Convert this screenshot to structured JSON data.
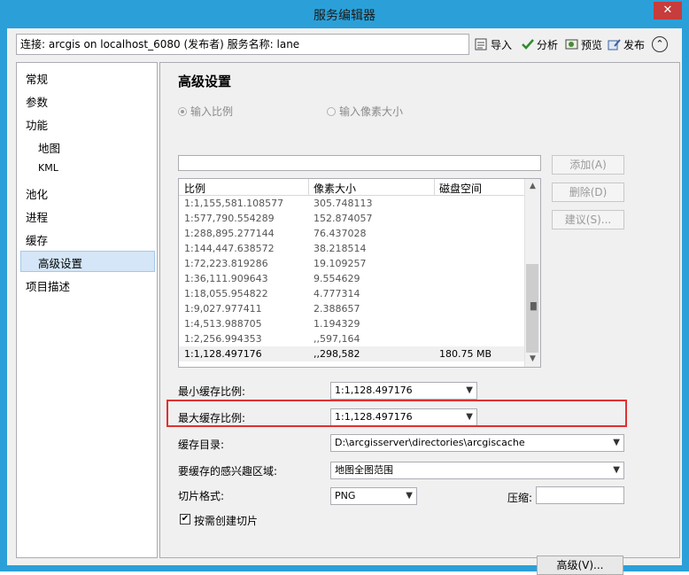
{
  "window": {
    "title": "服务编辑器",
    "close_glyph": "✕"
  },
  "toolbar": {
    "connection": "连接: arcgis on localhost_6080 (发布者)    服务名称: lane",
    "import_label": "导入",
    "analyze_label": "分析",
    "preview_label": "预览",
    "publish_label": "发布",
    "collapse_glyph": "⌃"
  },
  "sidebar": {
    "items": [
      {
        "label": "常规"
      },
      {
        "label": "参数"
      },
      {
        "label": "功能"
      },
      {
        "label": "地图"
      },
      {
        "label": "KML"
      },
      {
        "label": "池化"
      },
      {
        "label": "进程"
      },
      {
        "label": "缓存"
      },
      {
        "label": "高级设置"
      },
      {
        "label": "项目描述"
      }
    ],
    "selected": "高级设置"
  },
  "panel": {
    "title": "高级设置",
    "radio_scale": "输入比例",
    "radio_pixel": "输入像素大小",
    "add_button": "添加(A)",
    "delete_button": "删除(D)",
    "suggest_button": "建议(S)...",
    "grid": {
      "columns": [
        "比例",
        "像素大小",
        "磁盘空间"
      ],
      "rows": [
        [
          "1:1,155,581.108577",
          "305.748113",
          ""
        ],
        [
          "1:577,790.554289",
          "152.874057",
          ""
        ],
        [
          "1:288,895.277144",
          "76.437028",
          ""
        ],
        [
          "1:144,447.638572",
          "38.218514",
          ""
        ],
        [
          "1:72,223.819286",
          "19.109257",
          ""
        ],
        [
          "1:36,111.909643",
          "9.554629",
          ""
        ],
        [
          "1:18,055.954822",
          "4.777314",
          ""
        ],
        [
          "1:9,027.977411",
          "2.388657",
          ""
        ],
        [
          "1:4,513.988705",
          "1.194329",
          ""
        ],
        [
          "1:2,256.994353",
          ",,597,164",
          ""
        ],
        [
          "1:1,128.497176",
          ",,298,582",
          "180.75 MB"
        ]
      ]
    },
    "min_scale_label": "最小缓存比例:",
    "min_scale_value": "1:1,128.497176",
    "max_scale_label": "最大缓存比例:",
    "max_scale_value": "1:1,128.497176",
    "cache_dir_label": "缓存目录:",
    "cache_dir_value": "D:\\arcgisserver\\directories\\arcgiscache",
    "aoi_label": "要缓存的感兴趣区域:",
    "aoi_value": "地图全图范围",
    "tile_format_label": "切片格式:",
    "tile_format_value": "PNG",
    "compress_label": "压缩:",
    "on_demand_label": "按需创建切片",
    "on_demand_checked": true,
    "advanced_button": "高级(V)..."
  }
}
